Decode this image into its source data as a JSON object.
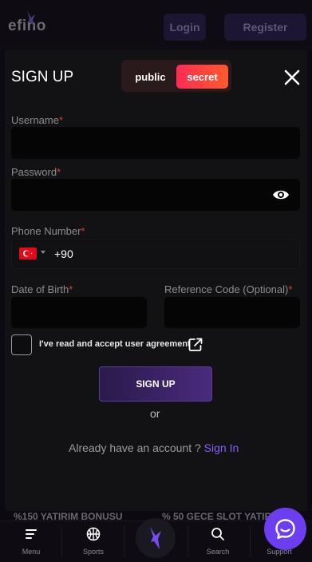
{
  "header": {
    "logo_text": "efino",
    "login_label": "Login",
    "register_label": "Register"
  },
  "modal": {
    "title": "SIGN UP",
    "toggle": {
      "public_label": "public",
      "secret_label": "secret",
      "selected": "secret"
    },
    "fields": {
      "username": {
        "label": "Username",
        "required_mark": "*",
        "value": ""
      },
      "password": {
        "label": "Password",
        "required_mark": "*",
        "value": ""
      },
      "phone": {
        "label": "Phone Number",
        "required_mark": "*",
        "country_code": "+90",
        "value": ""
      },
      "dob": {
        "label": "Date of Birth",
        "required_mark": "*",
        "value": ""
      },
      "reference": {
        "label": "Reference Code (Optional)",
        "required_mark": "*",
        "value": ""
      }
    },
    "agreement_text": "I've read and accept user agreement",
    "agreement_checked": false,
    "signup_button": "SIGN UP",
    "or_text": "or",
    "already_text": "Already have an account ?",
    "signin_link": "Sign In"
  },
  "marquee": {
    "item1": "%150 YATIRIM BONUSU",
    "item2": "% 50 GECE SLOT YATIR"
  },
  "bottom_nav": {
    "menu": "Menu",
    "sports": "Sports",
    "search": "Search",
    "support": "Support"
  },
  "colors": {
    "accent_purple": "#8a5cff",
    "secret_gradient_start": "#ff2c55",
    "secret_gradient_end": "#ff5a2a",
    "required": "#e23b3b"
  },
  "icons": [
    "bird-logo-icon",
    "eye-icon",
    "turkey-flag-icon",
    "external-link-icon",
    "close-icon",
    "menu-icon",
    "basketball-icon",
    "search-icon",
    "chat-icon"
  ]
}
